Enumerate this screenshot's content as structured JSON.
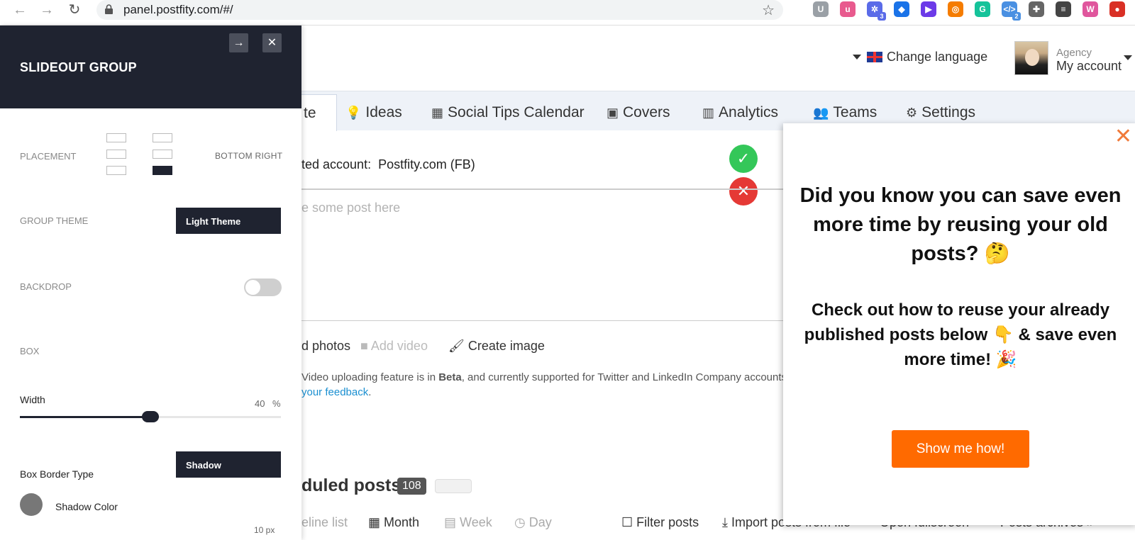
{
  "browser": {
    "url": "panel.postfity.com/#/",
    "extensions": [
      {
        "name": "ublock",
        "letter": "U",
        "color": "#9aa0a6",
        "badge": ""
      },
      {
        "name": "u",
        "letter": "u",
        "color": "#e85a8e",
        "badge": ""
      },
      {
        "name": "gear",
        "letter": "✲",
        "color": "#5a6be8",
        "badge": "3"
      },
      {
        "name": "bookmark",
        "letter": "◆",
        "color": "#1a73e8",
        "badge": ""
      },
      {
        "name": "play",
        "letter": "▶",
        "color": "#6c3ae8",
        "badge": ""
      },
      {
        "name": "orange",
        "letter": "◎",
        "color": "#f57c00",
        "badge": ""
      },
      {
        "name": "grammarly",
        "letter": "G",
        "color": "#15c39a",
        "badge": ""
      },
      {
        "name": "code",
        "letter": "</>",
        "color": "#4a90e2",
        "badge": "2"
      },
      {
        "name": "puzzle",
        "letter": "✚",
        "color": "#666",
        "badge": ""
      },
      {
        "name": "list",
        "letter": "≡",
        "color": "#444",
        "badge": ""
      },
      {
        "name": "profile",
        "letter": "W",
        "color": "#e0569d",
        "badge": ""
      },
      {
        "name": "red",
        "letter": "●",
        "color": "#d93025",
        "badge": ""
      }
    ]
  },
  "header": {
    "language_label": "Change language",
    "account_role": "Agency",
    "account_name": "My account"
  },
  "nav": {
    "create_fragment": "te",
    "items": [
      {
        "label": "Ideas",
        "icon": "💡"
      },
      {
        "label": "Social Tips Calendar",
        "icon": "▦"
      },
      {
        "label": "Covers",
        "icon": "▣"
      },
      {
        "label": "Analytics",
        "icon": "▥"
      },
      {
        "label": "Teams",
        "icon": "👥"
      },
      {
        "label": "Settings",
        "icon": "⚙"
      }
    ]
  },
  "content": {
    "account_prefix": "ted account:",
    "account_value": "Postfity.com (FB)",
    "post_placeholder": "e some post here",
    "add_photos": "d photos",
    "add_video": "Add video",
    "create_image": "Create image",
    "beta_note_pre": "Video uploading feature is in ",
    "beta_word": "Beta",
    "beta_note_post": ", and currently supported for Twitter and LinkedIn Company accounts o",
    "feedback_link": "your feedback",
    "scheduled_title": "duled posts",
    "scheduled_count": "108",
    "views": {
      "timeline": "eline list",
      "month": "Month",
      "week": "Week",
      "day": "Day",
      "filter": "Filter posts",
      "import": "Import posts from file",
      "fullscreen": "Open fullscreen",
      "archives": "Posts archives »"
    }
  },
  "slideout": {
    "title": "SLIDEOUT GROUP",
    "placement_label": "PLACEMENT",
    "placement_value": "BOTTOM RIGHT",
    "group_theme_label": "GROUP THEME",
    "group_theme_value": "Light Theme",
    "backdrop_label": "BACKDROP",
    "backdrop_on": false,
    "box_label": "BOX",
    "width_label": "Width",
    "width_value": "40",
    "width_unit": "%",
    "width_fraction": 0.5,
    "border_type_label": "Box Border Type",
    "border_type_value": "Shadow",
    "shadow_color_label": "Shadow Color",
    "shadow_color": "#777777",
    "shadow_size": "10 px"
  },
  "popup": {
    "headline": "Did you know you can save even more time by reusing your old posts? 🤔",
    "subheadline": "Check out how to reuse your already published posts below 👇 & save even more time! 🎉",
    "button_label": "Show me how!",
    "accent_color": "#ff6a00"
  },
  "colors": {
    "dark": "#1f2330",
    "success": "#34c759",
    "danger": "#e53935"
  }
}
